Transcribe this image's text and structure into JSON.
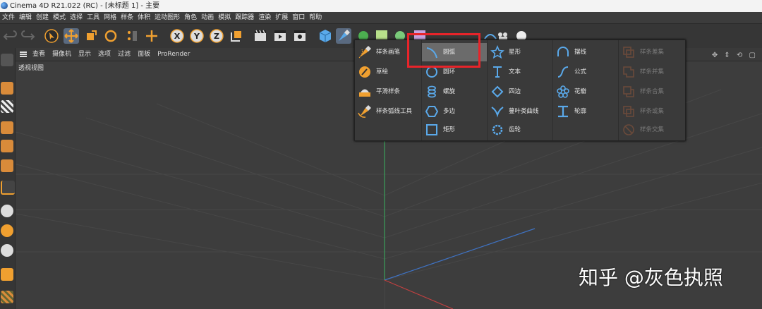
{
  "window": {
    "title": "Cinema 4D R21.022 (RC) - [未标题 1] - 主要"
  },
  "menubar": {
    "items": [
      "文件",
      "编辑",
      "创建",
      "模式",
      "选择",
      "工具",
      "网格",
      "样条",
      "体积",
      "运动图形",
      "角色",
      "动画",
      "模拟",
      "跟踪器",
      "渲染",
      "扩展",
      "窗口",
      "帮助"
    ]
  },
  "viewport": {
    "menu": [
      "查看",
      "摄像机",
      "显示",
      "选项",
      "过滤",
      "面板",
      "ProRender"
    ],
    "label": "透视视图",
    "nav_icons": "✥ ⇕ ⟲ ▢"
  },
  "spline_menu": {
    "col1": [
      {
        "label": "样条画笔",
        "icon": "pen-icon"
      },
      {
        "label": "草绘",
        "icon": "sketch-icon"
      },
      {
        "label": "平滑样条",
        "icon": "smooth-spline-icon"
      },
      {
        "label": "样条弧线工具",
        "icon": "arc-tool-icon"
      }
    ],
    "col2": [
      {
        "label": "圆弧",
        "icon": "arc-icon",
        "selected": true
      },
      {
        "label": "圆环",
        "icon": "circle-icon"
      },
      {
        "label": "螺旋",
        "icon": "helix-icon"
      },
      {
        "label": "多边",
        "icon": "polygon-icon"
      },
      {
        "label": "矩形",
        "icon": "rectangle-icon"
      }
    ],
    "col3": [
      {
        "label": "星形",
        "icon": "star-icon"
      },
      {
        "label": "文本",
        "icon": "text-icon"
      },
      {
        "label": "四边",
        "icon": "four-side-icon"
      },
      {
        "label": "蔓叶类曲线",
        "icon": "cissoid-icon"
      },
      {
        "label": "齿轮",
        "icon": "gear-icon"
      }
    ],
    "col4": [
      {
        "label": "摆线",
        "icon": "cycloid-icon"
      },
      {
        "label": "公式",
        "icon": "formula-icon"
      },
      {
        "label": "花瓣",
        "icon": "flower-icon"
      },
      {
        "label": "轮廓",
        "icon": "profile-icon"
      }
    ],
    "col5": [
      {
        "label": "样条差集",
        "icon": "spline-subtract-icon"
      },
      {
        "label": "样条并集",
        "icon": "spline-union-icon"
      },
      {
        "label": "样条合集",
        "icon": "spline-and-icon"
      },
      {
        "label": "样条或集",
        "icon": "spline-or-icon"
      },
      {
        "label": "样条交集",
        "icon": "spline-intersect-icon"
      }
    ]
  },
  "watermark": "知乎 @灰色执照",
  "colors": {
    "accent": "#e8242a",
    "bg": "#393939",
    "icon_blue": "#5aa9ea",
    "icon_orange": "#f0a030"
  }
}
